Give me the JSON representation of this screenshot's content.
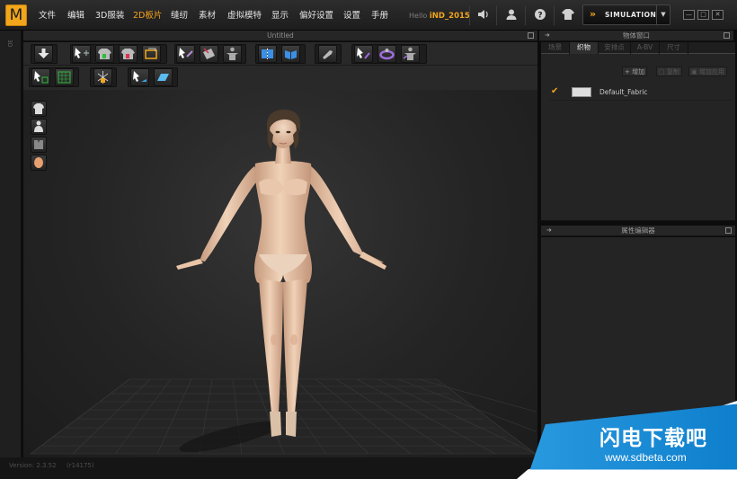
{
  "app": {
    "logo_letter": "M"
  },
  "menu": {
    "items": [
      "文件",
      "编辑",
      "3D服装",
      "2D板片",
      "缝纫",
      "素材",
      "虚拟模特",
      "显示",
      "偏好设置",
      "设置",
      "手册"
    ],
    "active_index": 3
  },
  "user": {
    "hello": "Hello",
    "name": "iND_2015"
  },
  "simulation": {
    "label": "SIMULATION"
  },
  "viewport": {
    "title": "Untitled"
  },
  "left_strip": {
    "tab_label": "3D"
  },
  "object_window": {
    "title": "物体窗口",
    "tabs": [
      "场景",
      "织物",
      "安排点",
      "A-BV",
      "尺寸"
    ],
    "active_tab": 1,
    "buttons": {
      "add": "+ 增加",
      "copy": "复制",
      "apply": "增加应用"
    },
    "fabrics": [
      {
        "name": "Default_Fabric",
        "checked": true,
        "swatch_color": "#dedede"
      }
    ]
  },
  "property_editor": {
    "title": "属性编辑器"
  },
  "status": {
    "version": "Version: 2.3.52",
    "build": "(r14175)"
  },
  "watermark": {
    "title": "闪电下载吧",
    "url": "www.sdbeta.com"
  },
  "colors": {
    "accent": "#f1a61b",
    "background": "#242424",
    "watermark_blue": "#1a8ed8"
  }
}
